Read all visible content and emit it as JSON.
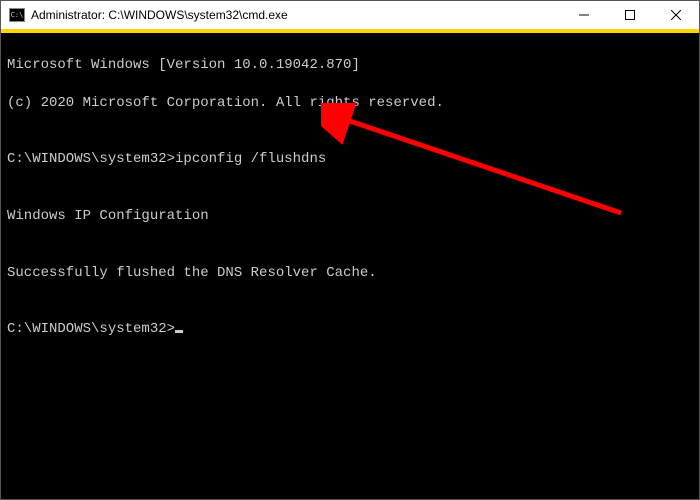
{
  "window": {
    "title": "Administrator: C:\\WINDOWS\\system32\\cmd.exe",
    "icon_label": "C:\\"
  },
  "terminal": {
    "lines": [
      "Microsoft Windows [Version 10.0.19042.870]",
      "(c) 2020 Microsoft Corporation. All rights reserved.",
      "",
      "C:\\WINDOWS\\system32>ipconfig /flushdns",
      "",
      "Windows IP Configuration",
      "",
      "Successfully flushed the DNS Resolver Cache.",
      "",
      "C:\\WINDOWS\\system32>"
    ],
    "prompt": "C:\\WINDOWS\\system32>",
    "last_command": "ipconfig /flushdns"
  },
  "controls": {
    "minimize": "minimize",
    "maximize": "maximize",
    "close": "close"
  },
  "annotation": {
    "type": "arrow",
    "color": "#ff0000"
  }
}
